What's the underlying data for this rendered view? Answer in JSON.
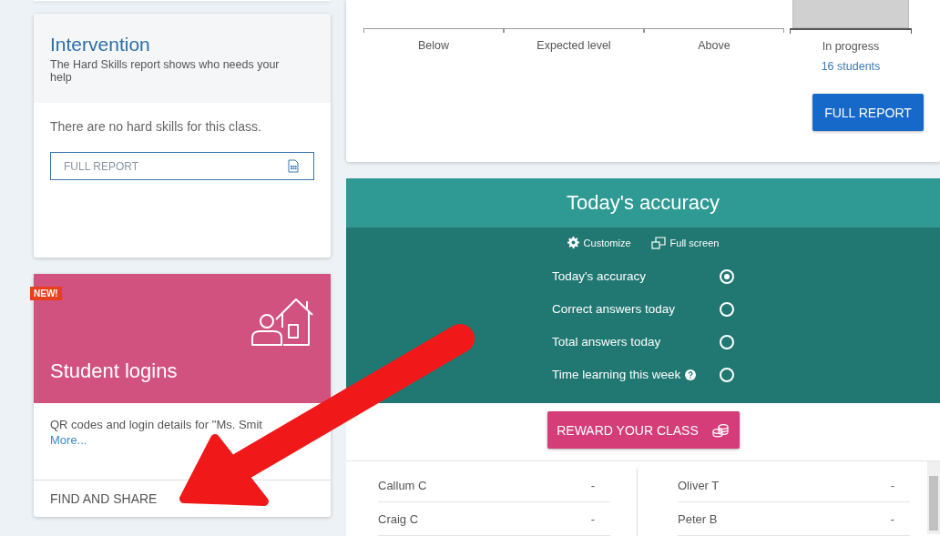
{
  "intervention": {
    "title": "Intervention",
    "subtitle": "The Hard Skills report shows who needs your help",
    "message": "There are no hard skills for this class.",
    "report_button": "FULL REPORT"
  },
  "student_logins": {
    "badge": "NEW!",
    "title": "Student logins",
    "description": "QR codes and login details for \"Ms. Smit",
    "link": "More...",
    "action": "FIND AND SHARE"
  },
  "progress_chart": {
    "categories": [
      {
        "label": "Below",
        "active": false
      },
      {
        "label": "Expected level",
        "active": false
      },
      {
        "label": "Above",
        "active": false
      },
      {
        "label": "In progress",
        "active": true,
        "count": "16 students"
      }
    ],
    "button": "FULL REPORT"
  },
  "accuracy": {
    "title": "Today's accuracy",
    "tools": [
      {
        "kind": "settings",
        "label": "Customize"
      },
      {
        "kind": "fullscreen",
        "label": "Full screen"
      }
    ],
    "options": [
      {
        "label": "Today's accuracy",
        "selected": true,
        "help": false
      },
      {
        "label": "Correct answers today",
        "selected": false,
        "help": false
      },
      {
        "label": "Total answers today",
        "selected": false,
        "help": false
      },
      {
        "label": "Time learning this week",
        "selected": false,
        "help": true
      }
    ]
  },
  "reward_button": "REWARD YOUR CLASS",
  "students": {
    "columns": [
      [
        {
          "name": "Callum C",
          "value": "-"
        },
        {
          "name": "Craig C",
          "value": "-"
        }
      ],
      [
        {
          "name": "Oliver T",
          "value": "-"
        },
        {
          "name": "Peter B",
          "value": "-"
        }
      ]
    ]
  }
}
